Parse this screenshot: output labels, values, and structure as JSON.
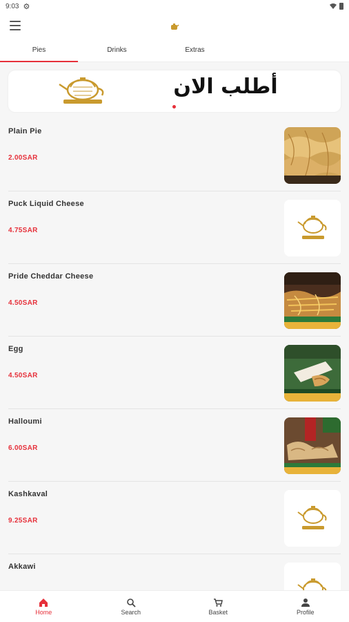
{
  "status_bar": {
    "time": "9:03"
  },
  "tabs": [
    {
      "label": "Pies"
    },
    {
      "label": "Drinks"
    },
    {
      "label": "Extras"
    }
  ],
  "banner": {
    "text": "أطلب الان"
  },
  "products": [
    {
      "name": "Plain Pie",
      "price": "2.00SAR",
      "image": "plain-pie-photo"
    },
    {
      "name": "Puck Liquid Cheese",
      "price": "4.75SAR",
      "image": "logo-placeholder"
    },
    {
      "name": "Pride Cheddar Cheese",
      "price": "4.50SAR",
      "image": "cheddar-pie-photo"
    },
    {
      "name": "Egg",
      "price": "4.50SAR",
      "image": "egg-pie-photo"
    },
    {
      "name": "Halloumi",
      "price": "6.00SAR",
      "image": "halloumi-pie-photo"
    },
    {
      "name": "Kashkaval",
      "price": "9.25SAR",
      "image": "logo-placeholder"
    },
    {
      "name": "Akkawi",
      "price": "",
      "image": "logo-placeholder"
    }
  ],
  "bottom_nav": [
    {
      "label": "Home",
      "icon": "home-icon"
    },
    {
      "label": "Search",
      "icon": "search-icon"
    },
    {
      "label": "Basket",
      "icon": "cart-icon"
    },
    {
      "label": "Profile",
      "icon": "profile-icon"
    }
  ],
  "colors": {
    "accent": "#e6303a",
    "background": "#f6f6f6",
    "logo_gold": "#c99a2e"
  }
}
